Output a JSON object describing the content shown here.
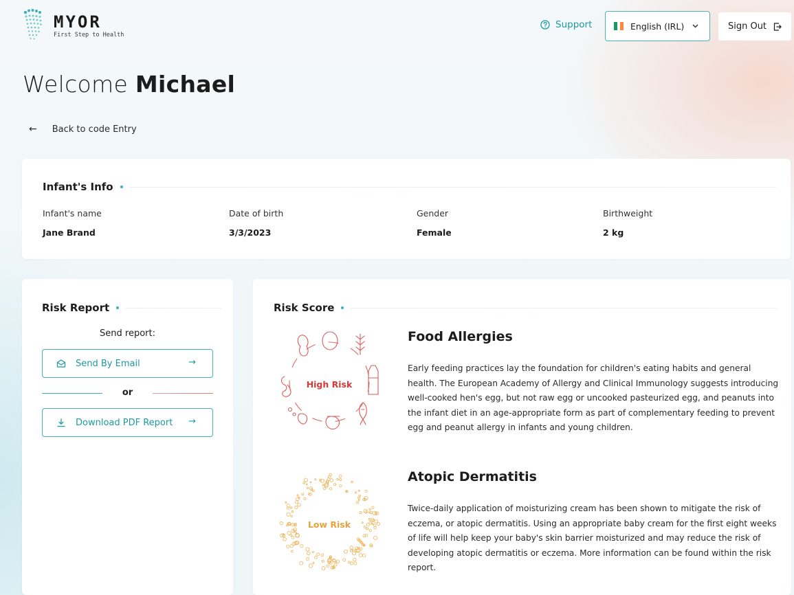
{
  "header": {
    "logo_word": "MYOR",
    "logo_tagline": "First Step to Health",
    "support_label": "Support",
    "language_label": "English (IRL)",
    "language_flag_colors": [
      "#169b62",
      "#ffffff",
      "#ff883e"
    ],
    "signout_label": "Sign Out"
  },
  "welcome": {
    "prefix": "Welcome",
    "name": "Michael"
  },
  "back_link": "Back to code Entry",
  "infant_info": {
    "title": "Infant's Info",
    "fields": [
      {
        "label": "Infant's name",
        "value": "Jane Brand"
      },
      {
        "label": "Date of birth",
        "value": "3/3/2023"
      },
      {
        "label": "Gender",
        "value": "Female"
      },
      {
        "label": "Birthweight",
        "value": "2 kg"
      }
    ]
  },
  "risk_report": {
    "title": "Risk Report",
    "send_label": "Send report:",
    "email_button": "Send By Email",
    "or_label": "or",
    "pdf_button": "Download PDF Report"
  },
  "risk_score": {
    "title": "Risk Score",
    "items": [
      {
        "title": "Food Allergies",
        "level": "High Risk",
        "level_color": "#d23a3a",
        "description": "Early feeding practices lay the foundation for children's eating habits and general health. The European Academy of Allergy and Clinical Immunology suggests introducing well-cooked hen's egg, but not raw egg or uncooked pasteurized egg, and peanuts into the infant diet in an age-appropriate form as part of complementary feeding to prevent egg and peanut allergy in infants and young children."
      },
      {
        "title": "Atopic Dermatitis",
        "level": "Low Risk",
        "level_color": "#e8a23c",
        "description": "Twice-daily application of moisturizing cream has been shown to mitigate the risk of eczema, or atopic dermatitis. Using an appropriate baby cream for the first eight weeks of life will help keep your baby's skin barrier moisturized and may reduce the risk of developing atopic dermatitis or eczema. More information can be found within the risk report."
      }
    ]
  },
  "colors": {
    "accent": "#46b0b5",
    "high_risk": "#d23a3a",
    "low_risk": "#e8a23c"
  }
}
